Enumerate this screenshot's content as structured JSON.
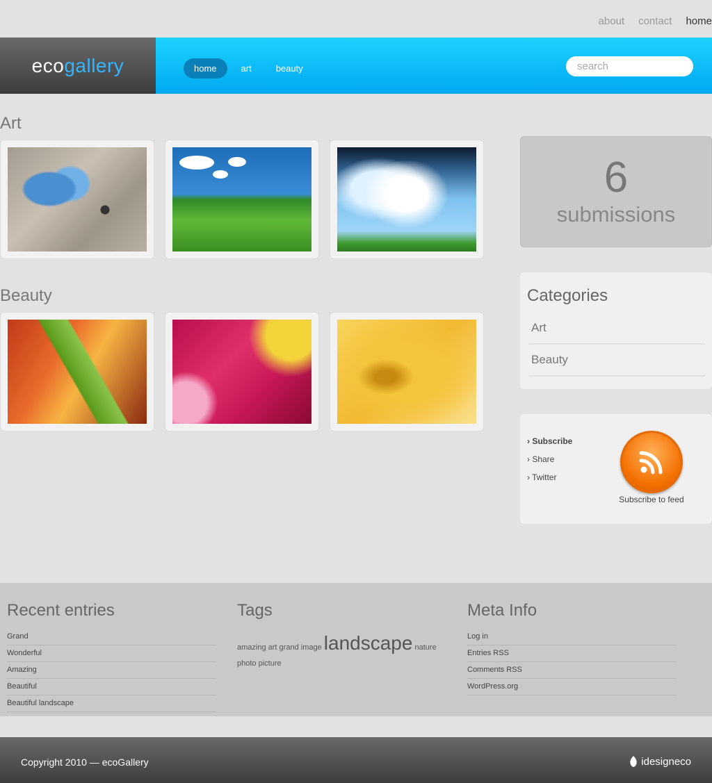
{
  "top_links": [
    {
      "label": "about"
    },
    {
      "label": "contact"
    },
    {
      "label": "home"
    }
  ],
  "logo": {
    "part1": "eco",
    "part2": "gallery"
  },
  "nav": [
    {
      "label": "home"
    },
    {
      "label": "art"
    },
    {
      "label": "beauty"
    }
  ],
  "search": {
    "placeholder": "search"
  },
  "sections": {
    "art": {
      "title": "Art"
    },
    "beauty": {
      "title": "Beauty"
    }
  },
  "submissions": {
    "count": "6",
    "label": "submissions"
  },
  "categories": {
    "title": "Categories",
    "items": [
      {
        "label": "Art"
      },
      {
        "label": "Beauty"
      }
    ]
  },
  "subscribe": {
    "links": [
      {
        "label": "› Subscribe"
      },
      {
        "label": "› Share"
      },
      {
        "label": "› Twitter"
      }
    ],
    "caption": "Subscribe to feed"
  },
  "recent": {
    "title": "Recent entries",
    "items": [
      "Grand",
      "Wonderful",
      "Amazing",
      "Beautiful",
      "Beautiful landscape"
    ]
  },
  "tags": {
    "title": "Tags",
    "items": [
      "amazing",
      "art",
      "grand",
      "image",
      "landscape",
      "nature",
      "photo",
      "picture"
    ]
  },
  "meta": {
    "title": "Meta Info",
    "items": [
      "Log in",
      "Entries RSS",
      "Comments RSS",
      "WordPress.org"
    ]
  },
  "footer": {
    "copyright": "Copyright 2010 — ecoGallery",
    "brand": "idesigneco"
  },
  "colors": {
    "accent": "#00a8f0",
    "nav_active": "#0a7fb8",
    "rss": "#f36f00"
  }
}
